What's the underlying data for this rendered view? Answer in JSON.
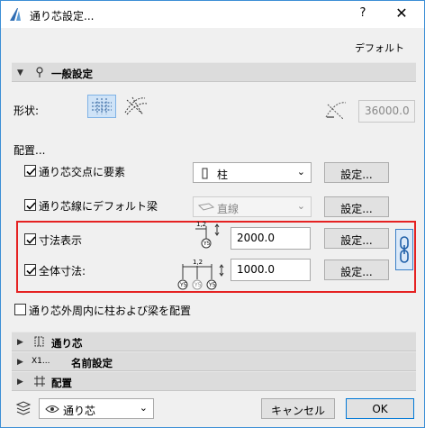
{
  "window": {
    "title": "通り芯設定...",
    "help": "?",
    "close": "✕"
  },
  "header": {
    "default_label": "デフォルト"
  },
  "general": {
    "section_label": "一般設定",
    "shape_label": "形状:",
    "angle_value": "36000.0"
  },
  "placement": {
    "label": "配置...",
    "intersection_element": {
      "label": "通り芯交点に要素",
      "checked": true,
      "select_value": "柱",
      "settings_label": "設定..."
    },
    "default_beam": {
      "label": "通り芯線にデフォルト梁",
      "checked": true,
      "select_value": "直線",
      "settings_label": "設定..."
    },
    "dimension": {
      "label": "寸法表示",
      "checked": true,
      "value": "2000.0",
      "settings_label": "設定..."
    },
    "overall_dimension": {
      "label": "全体寸法:",
      "checked": true,
      "value": "1000.0",
      "settings_label": "設定..."
    },
    "outer_perimeter": {
      "label": "通り芯外周内に柱および梁を配置",
      "checked": false
    }
  },
  "sections": {
    "gridline": "通り芯",
    "naming": "名前設定",
    "placement": "配置",
    "naming_prefix": "X1..."
  },
  "footer": {
    "layer_value": "通り芯",
    "cancel_label": "キャンセル",
    "ok_label": "OK"
  },
  "dim_icon_labels": {
    "single_top": "1,2",
    "single_bottom": "Y5",
    "multi_top": "1,2",
    "multi_b1": "Y5",
    "multi_b2": "Y5",
    "multi_b3": "Y5"
  },
  "colors": {
    "accent": "#0078d7",
    "highlight": "#e52222",
    "section_bg": "#dcdcdc"
  }
}
